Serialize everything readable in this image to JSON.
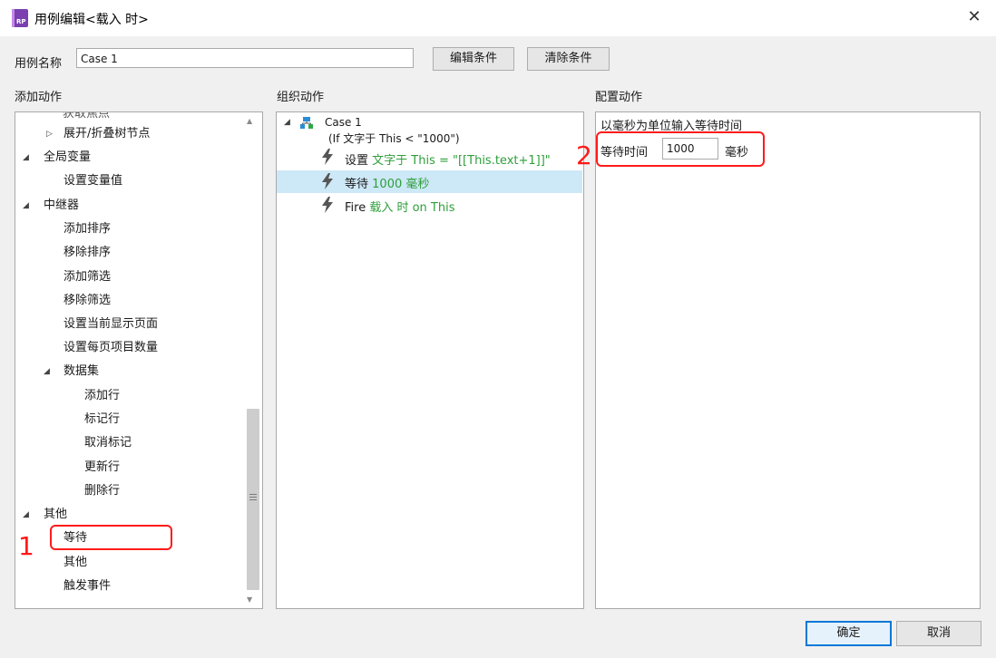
{
  "window": {
    "title": "用例编辑<载入 时>",
    "close_glyph": "✕"
  },
  "case_name": {
    "label": "用例名称",
    "value": "Case 1",
    "edit_condition": "编辑条件",
    "clear_condition": "清除条件"
  },
  "panels": {
    "add_action": "添加动作",
    "organize_action": "组织动作",
    "configure_action": "配置动作"
  },
  "add_action_tree": {
    "partial_top": "获取焦点",
    "expand_collapse": "展开/折叠树节点",
    "global_variable": "全局变量",
    "set_variable": "设置变量值",
    "repeater": "中继器",
    "add_sort": "添加排序",
    "remove_sort": "移除排序",
    "add_filter": "添加筛选",
    "remove_filter": "移除筛选",
    "set_current_page": "设置当前显示页面",
    "set_items_per_page": "设置每页项目数量",
    "dataset": "数据集",
    "add_row": "添加行",
    "mark_row": "标记行",
    "unmark_row": "取消标记",
    "update_row": "更新行",
    "delete_row": "删除行",
    "misc": "其他",
    "wait": "等待",
    "other": "其他",
    "fire_event": "触发事件"
  },
  "organize": {
    "case_title": "Case 1",
    "case_condition": "(If 文字于 This < \"1000\")",
    "action1_verb": "设置",
    "action1_detail": "文字于 This = \"[[This.text+1]]\"",
    "action2_verb": "等待",
    "action2_detail": "1000 毫秒",
    "action3_verb": "Fire",
    "action3_detail": "载入 时 on This"
  },
  "configure": {
    "instruction": "以毫秒为单位输入等待时间",
    "wait_label": "等待时间",
    "wait_value": "1000",
    "unit": "毫秒"
  },
  "annotations": {
    "marker1": "1",
    "marker2": "2"
  },
  "footer": {
    "ok": "确定",
    "cancel": "取消"
  },
  "colors": {
    "accent_blue": "#cce4f7",
    "highlight_red": "#ff1a1a",
    "green_text": "#2e9e3a",
    "icon_purple": "#7b3fb0"
  }
}
